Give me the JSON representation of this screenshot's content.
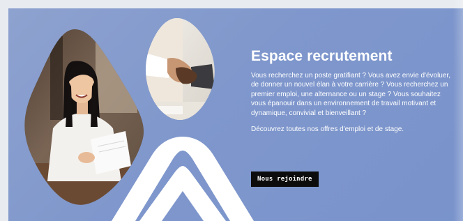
{
  "recruitment": {
    "title": "Espace recrutement",
    "intro": "Vous recherchez un poste gratifiant ? Vous avez envie d'évoluer, de donner un nouvel élan à votre carrière ? Vous recherchez un premier emploi, une alternance ou un stage ? Vous souhaitez vous épanouir dans un environnement de travail motivant et dynamique, convivial et bienveillant ?",
    "offers": "Découvrez toutes nos offres d'emploi et de stage.",
    "cta_label": "Nous rejoindre"
  },
  "colors": {
    "banner_bg": "#8098cc",
    "cta_bg": "#0c0c0c",
    "text": "#ffffff"
  },
  "images": {
    "main_photo": "smiling-woman-holding-documents-photo",
    "secondary_photo": "handshake-photo",
    "decor": "white-logo-arch-shape"
  }
}
